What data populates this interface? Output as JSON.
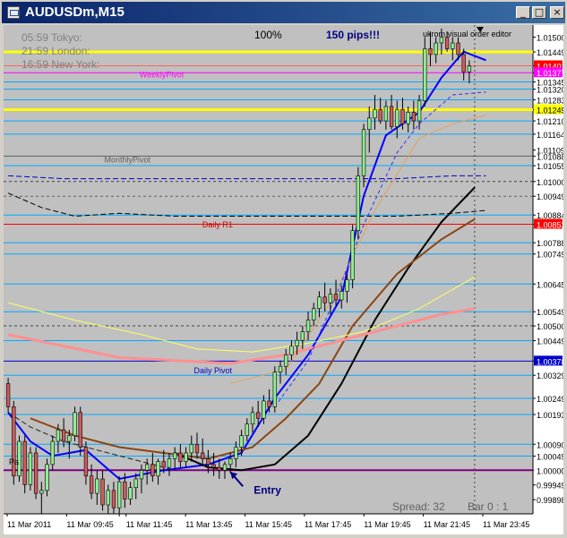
{
  "window": {
    "title": "AUDUSDm,M15",
    "minimize": "_",
    "maximize": "□",
    "close": "×"
  },
  "chart_data": {
    "type": "candlestick",
    "symbol": "AUDUSDm",
    "timeframe": "M15",
    "background": "#c0c0c0",
    "ylim": [
      0.99849,
      1.01542
    ],
    "y_ticks": [
      "1.01500",
      "1.01449",
      "1.01401",
      "1.01377",
      "1.01345",
      "1.01320",
      "1.01283",
      "1.01249",
      "1.01210",
      "1.01164",
      "1.01109",
      "1.01088",
      "1.01055",
      "1.01000",
      "1.00949",
      "1.00884",
      "1.00852",
      "1.00788",
      "1.00749",
      "1.00645",
      "1.00549",
      "1.00500",
      "1.00449",
      "1.00378",
      "1.00329",
      "1.00249",
      "1.00193",
      "1.00090",
      "1.00049",
      "1.00000",
      "0.99949",
      "0.99898"
    ],
    "x_ticks": [
      "11 Mar 2011",
      "11 Mar 09:45",
      "11 Mar 11:45",
      "11 Mar 13:45",
      "11 Mar 15:45",
      "11 Mar 17:45",
      "11 Mar 19:45",
      "11 Mar 21:45",
      "11 Mar 23:45"
    ],
    "highlight_labels": [
      {
        "value": "1.01401",
        "bg": "#ff0000",
        "fg": "#ffffff"
      },
      {
        "value": "1.01377",
        "bg": "#ff00ff",
        "fg": "#ffffff"
      },
      {
        "value": "1.01249",
        "bg": "#ffff00",
        "fg": "#000000"
      },
      {
        "value": "1.00852",
        "bg": "#ff0000",
        "fg": "#ffffff"
      },
      {
        "value": "1.00378",
        "bg": "#0000cc",
        "fg": "#ffffff"
      },
      {
        "value": "1.00000",
        "bg": "#ffffff",
        "fg": "#000000"
      }
    ],
    "session_times": [
      "05:59 Tokyo:",
      "21:59 London:",
      "16:59 New York:"
    ],
    "header_percent": "100%",
    "pips_label": "150 pips!!!",
    "indicator_label": "ukrom visual order editor",
    "pivot_labels": [
      {
        "text": "WeeklyPivot",
        "value": 1.0137,
        "x": 0.243,
        "color": "#ff00ff"
      },
      {
        "text": "MonthlyPivot",
        "value": 1.01075,
        "x": 0.18,
        "color": "#606060"
      },
      {
        "text": "Daily R1",
        "value": 1.0085,
        "x": 0.355,
        "color": "#cc0000"
      },
      {
        "text": "Daily Pivot",
        "value": 1.00345,
        "x": 0.34,
        "color": "#0000cc"
      }
    ],
    "entry_label": "Entry",
    "entry_bar": 40,
    "left_label": "Pa",
    "spread_label": "Spread: 32",
    "bar_label": "Bar  0 :  1",
    "candles": [
      [
        1.003,
        1.0032,
        1.002,
        1.0022
      ],
      [
        1.0022,
        1.0024,
        0.9995,
        0.9998
      ],
      [
        0.9998,
        1.0012,
        0.9996,
        1.001
      ],
      [
        1.001,
        1.0012,
        0.9992,
        0.9995
      ],
      [
        0.9995,
        1.0008,
        0.9993,
        1.0006
      ],
      [
        1.0006,
        1.0008,
        0.999,
        0.9992
      ],
      [
        0.9992,
        0.9996,
        0.9985,
        0.9993
      ],
      [
        0.9993,
        1.0004,
        0.9991,
        1.0002
      ],
      [
        1.0002,
        1.0012,
        1.0,
        1.001
      ],
      [
        1.001,
        1.0016,
        1.0006,
        1.0014
      ],
      [
        1.0014,
        1.0018,
        1.0008,
        1.001
      ],
      [
        1.001,
        1.0014,
        1.0004,
        1.0012
      ],
      [
        1.0012,
        1.0022,
        1.001,
        1.002
      ],
      [
        1.002,
        1.0022,
        1.0005,
        1.0008
      ],
      [
        1.0008,
        1.001,
        0.9995,
        0.9998
      ],
      [
        0.9998,
        1.0002,
        0.999,
        0.9992
      ],
      [
        0.9992,
        1.0,
        0.9988,
        0.9997
      ],
      [
        0.9997,
        1.0,
        0.9986,
        0.9988
      ],
      [
        0.9988,
        0.9995,
        0.9985,
        0.9993
      ],
      [
        0.9993,
        0.9996,
        0.9985,
        0.9987
      ],
      [
        0.9987,
        0.9998,
        0.9984,
        0.9996
      ],
      [
        0.9996,
        0.9999,
        0.9987,
        0.999
      ],
      [
        0.999,
        0.9996,
        0.9988,
        0.9994
      ],
      [
        0.9994,
        0.9999,
        0.999,
        0.9997
      ],
      [
        0.9997,
        1.0002,
        0.9992,
        1.0
      ],
      [
        1.0,
        1.0004,
        0.9995,
        1.0002
      ],
      [
        1.0002,
        1.0006,
        0.9996,
        0.9998
      ],
      [
        0.9998,
        1.0004,
        0.9995,
        1.0003
      ],
      [
        1.0003,
        1.0007,
        0.9999,
        1.0001
      ],
      [
        1.0001,
        1.0006,
        0.9998,
        1.0004
      ],
      [
        1.0004,
        1.0008,
        1.0,
        1.0006
      ],
      [
        1.0006,
        1.0009,
        1.0001,
        1.0003
      ],
      [
        1.0003,
        1.0008,
        1.0001,
        1.0006
      ],
      [
        1.0006,
        1.0012,
        1.0003,
        1.0009
      ],
      [
        1.0009,
        1.0013,
        1.0004,
        1.0006
      ],
      [
        1.0006,
        1.0011,
        1.0002,
        1.0004
      ],
      [
        1.0004,
        1.0007,
        0.9999,
        1.0002
      ],
      [
        1.0002,
        1.0006,
        0.9998,
        1.0001
      ],
      [
        1.0001,
        1.0004,
        0.9997,
        1.0
      ],
      [
        1.0,
        1.0003,
        0.9997,
        1.0002
      ],
      [
        1.0002,
        1.0006,
        0.9999,
        1.0004
      ],
      [
        1.0004,
        1.001,
        1.0001,
        1.0008
      ],
      [
        1.0008,
        1.0014,
        1.0005,
        1.0012
      ],
      [
        1.0012,
        1.0018,
        1.001,
        1.0016
      ],
      [
        1.0016,
        1.0022,
        1.0013,
        1.002
      ],
      [
        1.002,
        1.0024,
        1.0015,
        1.0018
      ],
      [
        1.0018,
        1.0026,
        1.0016,
        1.0024
      ],
      [
        1.0024,
        1.0028,
        1.002,
        1.0022
      ],
      [
        1.0022,
        1.0036,
        1.002,
        1.0034
      ],
      [
        1.0034,
        1.0038,
        1.003,
        1.0036
      ],
      [
        1.0036,
        1.0042,
        1.0033,
        1.004
      ],
      [
        1.004,
        1.0045,
        1.0038,
        1.0043
      ],
      [
        1.0043,
        1.0048,
        1.004,
        1.0045
      ],
      [
        1.0045,
        1.005,
        1.0042,
        1.0048
      ],
      [
        1.0048,
        1.0055,
        1.0045,
        1.0052
      ],
      [
        1.0052,
        1.0058,
        1.005,
        1.0056
      ],
      [
        1.0056,
        1.0062,
        1.0053,
        1.006
      ],
      [
        1.006,
        1.0065,
        1.0055,
        1.0058
      ],
      [
        1.0058,
        1.0063,
        1.0054,
        1.0061
      ],
      [
        1.0061,
        1.0066,
        1.0057,
        1.0059
      ],
      [
        1.0059,
        1.0064,
        1.0056,
        1.0062
      ],
      [
        1.0062,
        1.0068,
        1.0058,
        1.0066
      ],
      [
        1.0066,
        1.0085,
        1.0063,
        1.0083
      ],
      [
        1.0083,
        1.0105,
        1.008,
        1.0102
      ],
      [
        1.0102,
        1.012,
        1.0098,
        1.0118
      ],
      [
        1.0118,
        1.0126,
        1.011,
        1.0122
      ],
      [
        1.0122,
        1.013,
        1.0118,
        1.0125
      ],
      [
        1.0125,
        1.0129,
        1.012,
        1.0121
      ],
      [
        1.0121,
        1.0128,
        1.0118,
        1.0126
      ],
      [
        1.0126,
        1.013,
        1.0118,
        1.0119
      ],
      [
        1.0119,
        1.0128,
        1.0115,
        1.0125
      ],
      [
        1.0125,
        1.0129,
        1.0118,
        1.012
      ],
      [
        1.012,
        1.0126,
        1.0117,
        1.0124
      ],
      [
        1.0124,
        1.0128,
        1.0118,
        1.0121
      ],
      [
        1.0121,
        1.013,
        1.0118,
        1.0128
      ],
      [
        1.0128,
        1.015,
        1.0126,
        1.0146
      ],
      [
        1.0146,
        1.0152,
        1.014,
        1.0144
      ],
      [
        1.0144,
        1.015,
        1.0141,
        1.0148
      ],
      [
        1.0148,
        1.0153,
        1.0144,
        1.015
      ],
      [
        1.015,
        1.0152,
        1.0145,
        1.0146
      ],
      [
        1.0146,
        1.015,
        1.0142,
        1.0148
      ],
      [
        1.0148,
        1.015,
        1.0142,
        1.0144
      ],
      [
        1.0144,
        1.0146,
        1.0135,
        1.0138
      ],
      [
        1.0138,
        1.0142,
        1.0134,
        1.014
      ]
    ],
    "bar_lines": [
      {
        "value": 1.01449,
        "color": "#ffff00",
        "width": 3
      },
      {
        "value": 1.01401,
        "color": "#ff6060",
        "width": 1
      },
      {
        "value": 1.01377,
        "color": "#ff00ff",
        "width": 1
      },
      {
        "value": 1.01345,
        "color": "#00aaff",
        "width": 1
      },
      {
        "value": 1.0132,
        "color": "#00aaff",
        "width": 1
      },
      {
        "value": 1.01283,
        "color": "#00aaff",
        "width": 1
      },
      {
        "value": 1.01249,
        "color": "#ffff00",
        "width": 3
      },
      {
        "value": 1.0121,
        "color": "#00aaff",
        "width": 1
      },
      {
        "value": 1.01164,
        "color": "#00aaff",
        "width": 1
      },
      {
        "value": 1.01088,
        "color": "#606060",
        "width": 1
      },
      {
        "value": 1.01055,
        "color": "#00aaff",
        "width": 1
      },
      {
        "value": 1.00884,
        "color": "#00aaff",
        "width": 1
      },
      {
        "value": 1.00852,
        "color": "#ff0000",
        "width": 1
      },
      {
        "value": 1.00788,
        "color": "#00aaff",
        "width": 1
      },
      {
        "value": 1.00749,
        "color": "#00aaff",
        "width": 1
      },
      {
        "value": 1.00645,
        "color": "#00aaff",
        "width": 1
      },
      {
        "value": 1.00549,
        "color": "#00aaff",
        "width": 1
      },
      {
        "value": 1.00449,
        "color": "#00aaff",
        "width": 1
      },
      {
        "value": 1.00378,
        "color": "#0000cc",
        "width": 1
      },
      {
        "value": 1.00329,
        "color": "#00aaff",
        "width": 1
      },
      {
        "value": 1.00249,
        "color": "#00aaff",
        "width": 1
      },
      {
        "value": 1.00193,
        "color": "#00aaff",
        "width": 1
      },
      {
        "value": 1.0009,
        "color": "#00aaff",
        "width": 1
      },
      {
        "value": 1.00049,
        "color": "#00aaff",
        "width": 1
      },
      {
        "value": 1.0,
        "color": "#800080",
        "width": 2
      }
    ],
    "dash_lines": [
      {
        "value": 1.01,
        "color": "#404040"
      },
      {
        "value": 1.005,
        "color": "#404040"
      },
      {
        "value": 1.00949,
        "color": "#606060"
      }
    ],
    "moving_averages": [
      {
        "color": "#0000ff",
        "width": 2,
        "points": [
          [
            0,
            1.002
          ],
          [
            4,
            1.001
          ],
          [
            8,
            1.0005
          ],
          [
            14,
            1.0007
          ],
          [
            20,
            0.9997
          ],
          [
            28,
            1.0
          ],
          [
            36,
            1.0002
          ],
          [
            42,
            1.0006
          ],
          [
            48,
            1.0025
          ],
          [
            54,
            1.004
          ],
          [
            60,
            1.006
          ],
          [
            64,
            1.0095
          ],
          [
            68,
            1.0116
          ],
          [
            74,
            1.0124
          ],
          [
            78,
            1.0136
          ],
          [
            82,
            1.0145
          ],
          [
            86,
            1.0142
          ]
        ]
      },
      {
        "color": "#000000",
        "width": 2,
        "points": [
          [
            30,
            1.0006
          ],
          [
            36,
            1.0001
          ],
          [
            42,
            1.0
          ],
          [
            48,
            1.0002
          ],
          [
            54,
            1.0012
          ],
          [
            60,
            1.003
          ],
          [
            66,
            1.0052
          ],
          [
            72,
            1.007
          ],
          [
            78,
            1.0086
          ],
          [
            84,
            1.0098
          ]
        ]
      },
      {
        "color": "#8b4513",
        "width": 2,
        "points": [
          [
            4,
            1.0018
          ],
          [
            12,
            1.0012
          ],
          [
            20,
            1.0008
          ],
          [
            28,
            1.0006
          ],
          [
            36,
            1.0004
          ],
          [
            44,
            1.0008
          ],
          [
            50,
            1.0018
          ],
          [
            56,
            1.003
          ],
          [
            62,
            1.005
          ],
          [
            70,
            1.0068
          ],
          [
            78,
            1.008
          ],
          [
            84,
            1.0087
          ]
        ]
      },
      {
        "color": "#ff9090",
        "width": 3,
        "points": [
          [
            0,
            1.0047
          ],
          [
            10,
            1.0043
          ],
          [
            20,
            1.0039
          ],
          [
            30,
            1.0038
          ],
          [
            40,
            1.0037
          ],
          [
            50,
            1.004
          ],
          [
            60,
            1.0045
          ],
          [
            70,
            1.005
          ],
          [
            78,
            1.0054
          ],
          [
            84,
            1.0056
          ]
        ]
      },
      {
        "color": "#ffff60",
        "width": 1,
        "points": [
          [
            0,
            1.0058
          ],
          [
            12,
            1.0052
          ],
          [
            24,
            1.0047
          ],
          [
            34,
            1.0042
          ],
          [
            44,
            1.0041
          ],
          [
            54,
            1.0044
          ],
          [
            64,
            1.0048
          ],
          [
            74,
            1.0056
          ],
          [
            84,
            1.0067
          ]
        ]
      },
      {
        "color": "#e0a060",
        "width": 1,
        "points": [
          [
            40,
            1.003
          ],
          [
            50,
            1.0035
          ],
          [
            58,
            1.0058
          ],
          [
            66,
            1.009
          ],
          [
            74,
            1.0115
          ],
          [
            80,
            1.012
          ],
          [
            86,
            1.0123
          ]
        ]
      },
      {
        "color": "#3030ff",
        "width": 1,
        "dash": true,
        "points": [
          [
            48,
            1.0022
          ],
          [
            54,
            1.0038
          ],
          [
            60,
            1.0065
          ],
          [
            64,
            1.0085
          ],
          [
            70,
            1.011
          ],
          [
            74,
            1.012
          ],
          [
            80,
            1.013
          ],
          [
            86,
            1.0131
          ]
        ]
      }
    ]
  }
}
